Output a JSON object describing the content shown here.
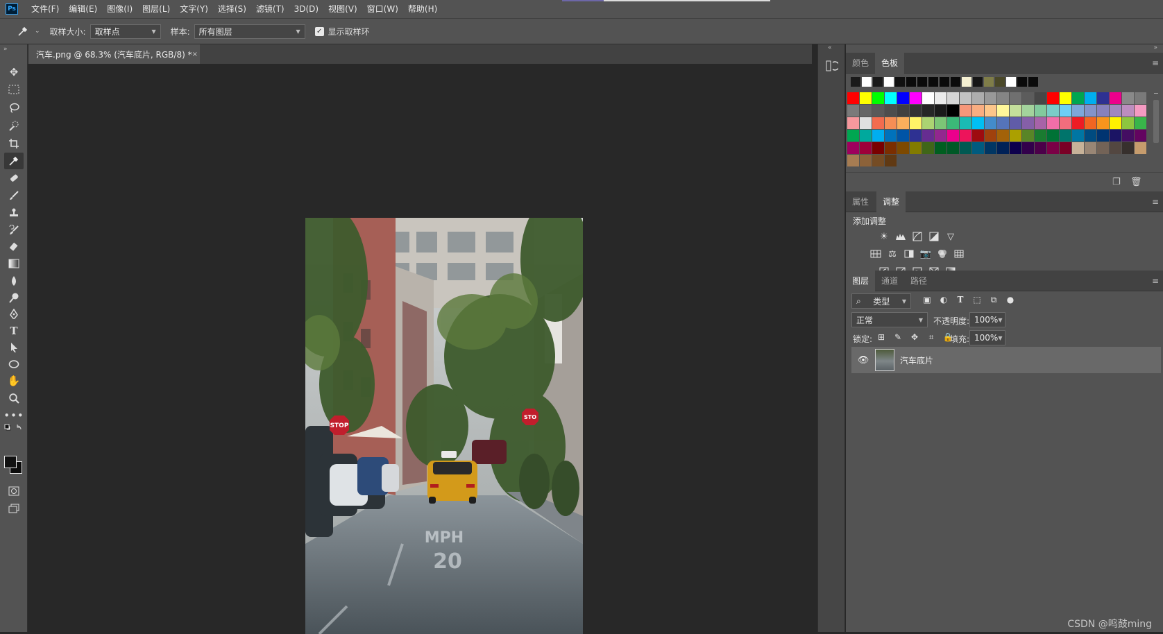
{
  "app": {
    "logo": "Ps"
  },
  "menu": [
    "文件(F)",
    "编辑(E)",
    "图像(I)",
    "图层(L)",
    "文字(Y)",
    "选择(S)",
    "滤镜(T)",
    "3D(D)",
    "视图(V)",
    "窗口(W)",
    "帮助(H)"
  ],
  "options": {
    "sample_size_label": "取样大小:",
    "sample_size_value": "取样点",
    "sample_label": "样本:",
    "sample_value": "所有图层",
    "show_ring_label": "显示取样环",
    "show_ring_checked": true
  },
  "document": {
    "tab_title": "汽车.png @ 68.3% (汽车底片, RGB/8) *",
    "close_glyph": "×",
    "photo_signs": {
      "stop_left": "STOP",
      "stop_right": "STO",
      "road_marking_1": "MPH",
      "road_marking_2": "20"
    }
  },
  "panels": {
    "color_tabs": [
      "颜色",
      "色板"
    ],
    "swatches_active": "色板",
    "props_tabs": [
      "属性",
      "调整"
    ],
    "props_active": "调整",
    "adjust_title": "添加调整",
    "layer_tabs": [
      "图层",
      "通道",
      "路径"
    ],
    "layer_active": "图层",
    "filter_label": "类型",
    "blend_mode": "正常",
    "opacity_label": "不透明度:",
    "opacity_value": "100%",
    "lock_label": "锁定:",
    "fill_label": "填充:",
    "fill_value": "100%",
    "layer_name": "汽车底片"
  },
  "watermark": "CSDN @鸣鼓ming",
  "swatches": {
    "recent": [
      "#1a1a1a",
      "#ffffff",
      "#1a1a1a",
      "#ffffff",
      "#111111",
      "#0b0b0b",
      "#0b0b0b",
      "#0b0b0b",
      "#0b0b0b",
      "#0b0b0b",
      "#f5f0d2",
      "#161616",
      "#7f7d49",
      "#4a4828",
      "#ffffff",
      "#0b0b0b",
      "#0b0b0b"
    ],
    "grid": [
      "#ff0000",
      "#ffff00",
      "#00ff00",
      "#00ffff",
      "#0000ff",
      "#ff00ff",
      "#ffffff",
      "#ebebeb",
      "#d6d6d6",
      "#c2c2c2",
      "#adadad",
      "#999999",
      "#858585",
      "#707070",
      "#5c5c5c",
      "#474747",
      "#ff0000",
      "#ffff00",
      "#00a651",
      "#00aeef",
      "#2e3192",
      "#ec008c",
      "#898989",
      "#7a7a7a",
      "#7a7a7a",
      "#666666",
      "#595959",
      "#4d4d4d",
      "#404040",
      "#333333",
      "#262626",
      "#1a1a1a",
      "#000000",
      "#f7977a",
      "#f9ad81",
      "#fdc68a",
      "#fff79a",
      "#c4df9b",
      "#a3d39c",
      "#82ca9d",
      "#7accc8",
      "#6dcff6",
      "#7da7d9",
      "#8393ca",
      "#8781bd",
      "#a187be",
      "#bc8dbf",
      "#f49ac2",
      "#f6989d",
      "#e0e0e0",
      "#f26c4f",
      "#f68e55",
      "#fbaf5c",
      "#fff467",
      "#acd372",
      "#7cc576",
      "#3bb878",
      "#1abbb4",
      "#00bff3",
      "#438ccb",
      "#5574b9",
      "#605ca8",
      "#855fa8",
      "#a763a8",
      "#f06ea9",
      "#f26d7d",
      "#ed1c24",
      "#f26522",
      "#f7941d",
      "#fff200",
      "#8dc63f",
      "#39b54a",
      "#00a651",
      "#00a99d",
      "#00aeef",
      "#0072bc",
      "#0054a6",
      "#2e3192",
      "#662d91",
      "#92278f",
      "#ec008c",
      "#ed145b",
      "#9e0b0f",
      "#a0410d",
      "#a36209",
      "#aba000",
      "#598527",
      "#1a7b30",
      "#007236",
      "#00746b",
      "#0076a3",
      "#004b80",
      "#003471",
      "#1b1464",
      "#440e62",
      "#630460",
      "#9e005d",
      "#9e0039",
      "#790000",
      "#7b2e00",
      "#7d4900",
      "#827b00",
      "#406618",
      "#005e20",
      "#005826",
      "#005952",
      "#005b7f",
      "#003663",
      "#002157",
      "#0d004c",
      "#32004b",
      "#4b0049",
      "#7b0046",
      "#7a0026",
      "#c7b299",
      "#998675",
      "#736357",
      "#534741",
      "#37302d",
      "#c69c6d",
      "#a67c52",
      "#8c6239",
      "#754c24",
      "#603913"
    ]
  }
}
